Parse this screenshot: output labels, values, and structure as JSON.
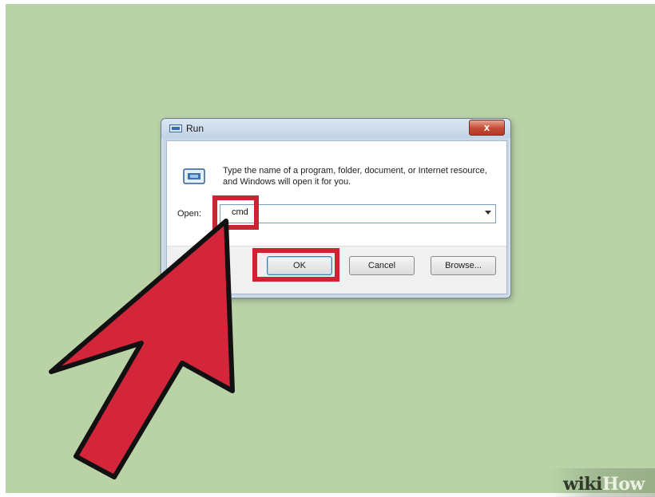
{
  "dialog": {
    "title": "Run",
    "close_glyph": "x",
    "description": "Type the name of a program, folder, document, or Internet resource, and Windows will open it for you.",
    "open_label": "Open:",
    "open_value": "cmd",
    "buttons": {
      "ok": "OK",
      "cancel": "Cancel",
      "browse": "Browse..."
    },
    "icons": [
      "run-icon",
      "dropdown-arrow-icon",
      "close-icon"
    ]
  },
  "annotations": {
    "highlight_color": "#cf2233",
    "arrow_color": "#d3263a"
  },
  "watermark": {
    "part1": "wiki",
    "part2": "How"
  },
  "colors": {
    "background": "#b9d3a7",
    "dialog_frame": "#c8d8e8"
  }
}
